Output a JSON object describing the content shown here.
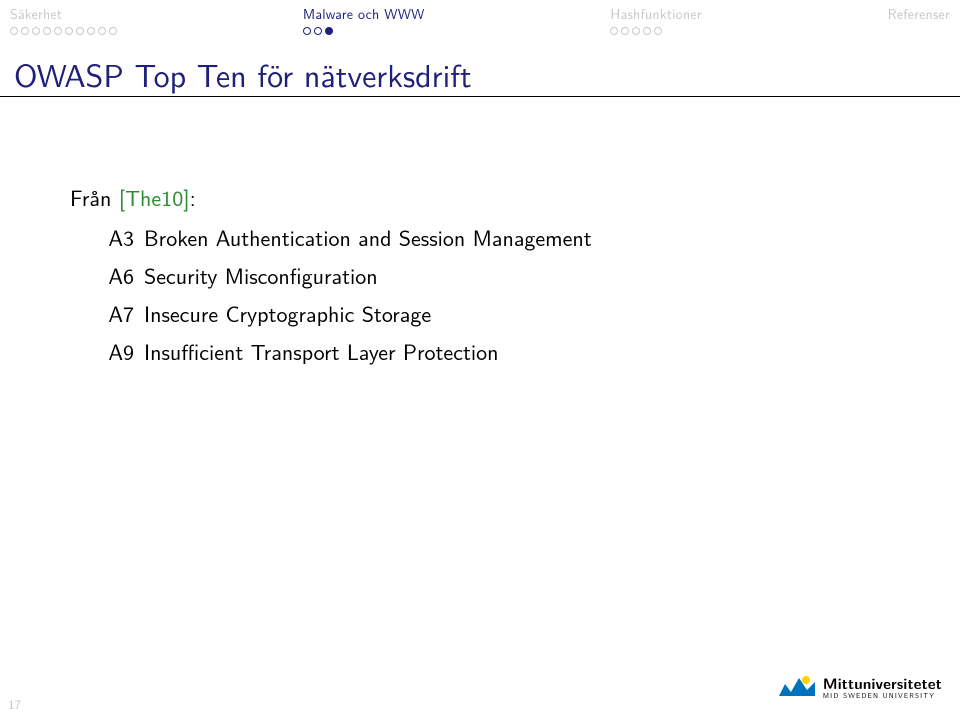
{
  "nav": {
    "sections": [
      {
        "label": "Säkerhet",
        "current": false,
        "dots": 10,
        "filled_index": -1
      },
      {
        "label": "Malware och WWW",
        "current": true,
        "dots": 3,
        "filled_index": 2
      },
      {
        "label": "Hashfunktioner",
        "current": false,
        "dots": 5,
        "filled_index": -1
      },
      {
        "label": "Referenser",
        "current": false,
        "dots": 0,
        "filled_index": -1
      }
    ]
  },
  "title": "OWASP Top Ten för nätverksdrift",
  "intro": {
    "prefix": "Från ",
    "cite": "[The10]",
    "suffix": ":"
  },
  "items": [
    {
      "key": "A3",
      "text": "Broken Authentication and Session Management"
    },
    {
      "key": "A6",
      "text": "Security Misconfiguration"
    },
    {
      "key": "A7",
      "text": "Insecure Cryptographic Storage"
    },
    {
      "key": "A9",
      "text": "Insufficient Transport Layer Protection"
    }
  ],
  "page_number": "17",
  "logo": {
    "name": "Mittuniversitetet",
    "tagline": "MID SWEDEN UNIVERSITY",
    "colors": {
      "blue": "#0072bc",
      "yellow": "#ffd200"
    }
  }
}
